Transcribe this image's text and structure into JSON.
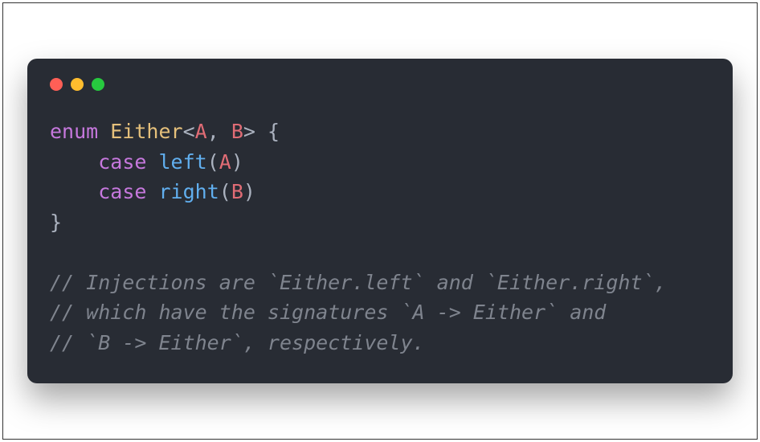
{
  "code": {
    "line1": {
      "kw": "enum",
      "sp1": " ",
      "type": "Either",
      "lt": "<",
      "paramA": "A",
      "comma": ", ",
      "paramB": "B",
      "gt": ">",
      "sp2": " ",
      "brace": "{"
    },
    "line2": {
      "indent": "    ",
      "kw": "case",
      "sp": " ",
      "name": "left",
      "lp": "(",
      "param": "A",
      "rp": ")"
    },
    "line3": {
      "indent": "    ",
      "kw": "case",
      "sp": " ",
      "name": "right",
      "lp": "(",
      "param": "B",
      "rp": ")"
    },
    "line4": {
      "brace": "}"
    },
    "comment1": "// Injections are `Either.left` and `Either.right`,",
    "comment2": "// which have the signatures `A -> Either` and",
    "comment3": "// `B -> Either`, respectively."
  }
}
